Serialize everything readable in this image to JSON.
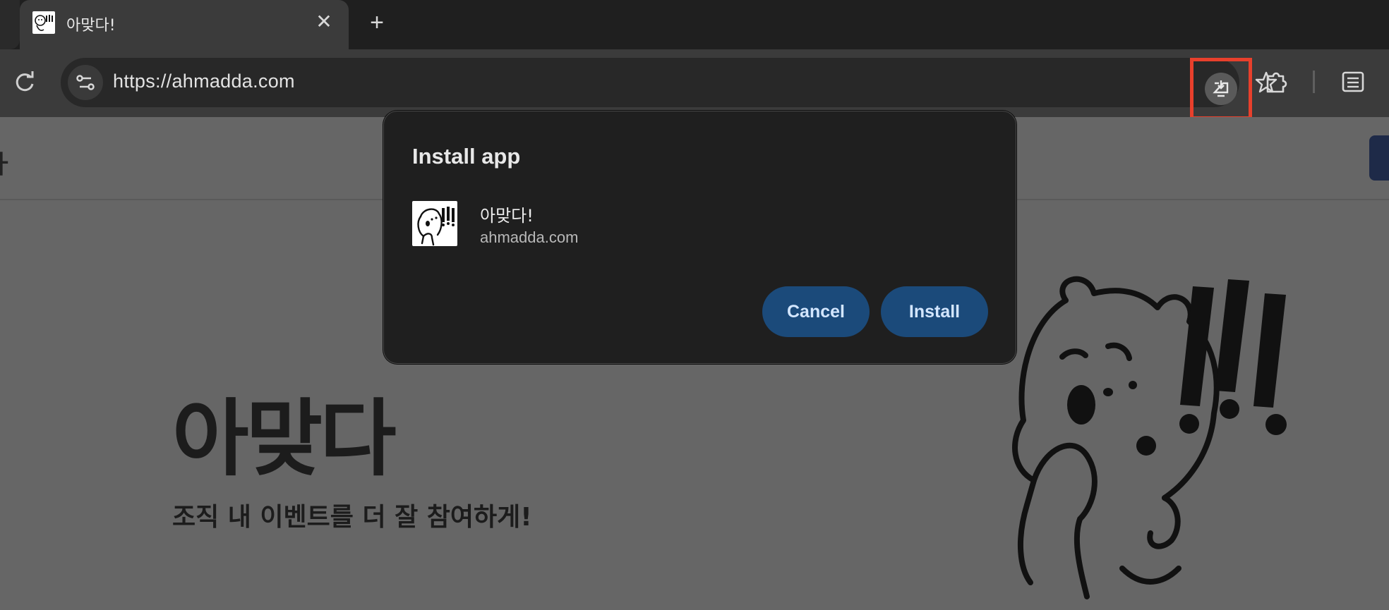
{
  "browser": {
    "tab": {
      "title": "아맞다!",
      "close": "✕"
    },
    "new_tab": "+",
    "omnibox": {
      "url": "https://ahmadda.com"
    }
  },
  "dialog": {
    "title": "Install app",
    "app_name": "아맞다!",
    "app_url": "ahmadda.com",
    "cancel_label": "Cancel",
    "install_label": "Install"
  },
  "page": {
    "nav_fragment": "ㅏ",
    "hero_title": "아맞다",
    "hero_subtitle": "조직 내 이벤트를 더 잘 참여하게!"
  },
  "colors": {
    "highlight": "#e8402c",
    "button": "#1b4a7a"
  },
  "icons": [
    "reload-icon",
    "site-info-icon",
    "install-app-icon",
    "bookmark-star-icon",
    "extensions-icon",
    "side-panel-icon"
  ]
}
